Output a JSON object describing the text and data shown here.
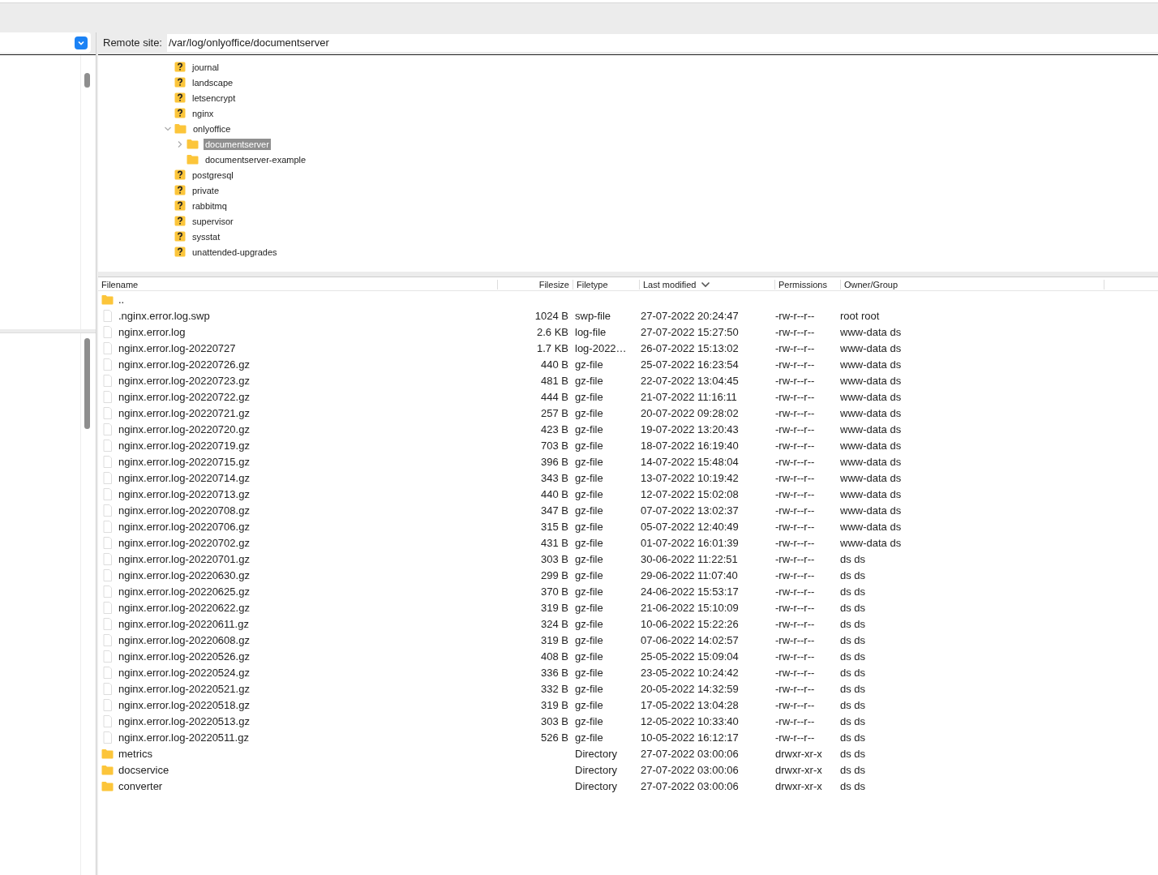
{
  "remote_site": {
    "label": "Remote site:",
    "path": "/var/log/onlyoffice/documentserver"
  },
  "tree": [
    {
      "name": "journal",
      "kind": "unknown",
      "selected": false
    },
    {
      "name": "landscape",
      "kind": "unknown",
      "selected": false
    },
    {
      "name": "letsencrypt",
      "kind": "unknown",
      "selected": false
    },
    {
      "name": "nginx",
      "kind": "unknown",
      "selected": false
    },
    {
      "name": "onlyoffice",
      "kind": "folder",
      "selected": false,
      "expanded": true,
      "children": [
        {
          "name": "documentserver",
          "kind": "folder",
          "selected": true,
          "expanded": false
        },
        {
          "name": "documentserver-example",
          "kind": "folder",
          "selected": false
        }
      ]
    },
    {
      "name": "postgresql",
      "kind": "unknown",
      "selected": false
    },
    {
      "name": "private",
      "kind": "unknown",
      "selected": false
    },
    {
      "name": "rabbitmq",
      "kind": "unknown",
      "selected": false
    },
    {
      "name": "supervisor",
      "kind": "unknown",
      "selected": false
    },
    {
      "name": "sysstat",
      "kind": "unknown",
      "selected": false
    },
    {
      "name": "unattended-upgrades",
      "kind": "unknown",
      "selected": false
    }
  ],
  "columns": [
    {
      "label": "Filename",
      "sorted": false
    },
    {
      "label": "Filesize",
      "sorted": false
    },
    {
      "label": "Filetype",
      "sorted": false
    },
    {
      "label": "Last modified",
      "sorted": true
    },
    {
      "label": "Permissions",
      "sorted": false
    },
    {
      "label": "Owner/Group",
      "sorted": false
    }
  ],
  "rows": [
    {
      "kind": "folder",
      "name": ".."
    },
    {
      "kind": "file",
      "name": ".nginx.error.log.swp",
      "size": "1024 B",
      "type": "swp-file",
      "modified": "27-07-2022 20:24:47",
      "perms": "-rw-r--r--",
      "owner": "root root"
    },
    {
      "kind": "file",
      "name": "nginx.error.log",
      "size": "2.6 KB",
      "type": "log-file",
      "modified": "27-07-2022 15:27:50",
      "perms": "-rw-r--r--",
      "owner": "www-data ds"
    },
    {
      "kind": "file",
      "name": "nginx.error.log-20220727",
      "size": "1.7 KB",
      "type": "log-2022…",
      "modified": "26-07-2022 15:13:02",
      "perms": "-rw-r--r--",
      "owner": "www-data ds"
    },
    {
      "kind": "file",
      "name": "nginx.error.log-20220726.gz",
      "size": "440 B",
      "type": "gz-file",
      "modified": "25-07-2022 16:23:54",
      "perms": "-rw-r--r--",
      "owner": "www-data ds"
    },
    {
      "kind": "file",
      "name": "nginx.error.log-20220723.gz",
      "size": "481 B",
      "type": "gz-file",
      "modified": "22-07-2022 13:04:45",
      "perms": "-rw-r--r--",
      "owner": "www-data ds"
    },
    {
      "kind": "file",
      "name": "nginx.error.log-20220722.gz",
      "size": "444 B",
      "type": "gz-file",
      "modified": "21-07-2022 11:16:11",
      "perms": "-rw-r--r--",
      "owner": "www-data ds"
    },
    {
      "kind": "file",
      "name": "nginx.error.log-20220721.gz",
      "size": "257 B",
      "type": "gz-file",
      "modified": "20-07-2022 09:28:02",
      "perms": "-rw-r--r--",
      "owner": "www-data ds"
    },
    {
      "kind": "file",
      "name": "nginx.error.log-20220720.gz",
      "size": "423 B",
      "type": "gz-file",
      "modified": "19-07-2022 13:20:43",
      "perms": "-rw-r--r--",
      "owner": "www-data ds"
    },
    {
      "kind": "file",
      "name": "nginx.error.log-20220719.gz",
      "size": "703 B",
      "type": "gz-file",
      "modified": "18-07-2022 16:19:40",
      "perms": "-rw-r--r--",
      "owner": "www-data ds"
    },
    {
      "kind": "file",
      "name": "nginx.error.log-20220715.gz",
      "size": "396 B",
      "type": "gz-file",
      "modified": "14-07-2022 15:48:04",
      "perms": "-rw-r--r--",
      "owner": "www-data ds"
    },
    {
      "kind": "file",
      "name": "nginx.error.log-20220714.gz",
      "size": "343 B",
      "type": "gz-file",
      "modified": "13-07-2022 10:19:42",
      "perms": "-rw-r--r--",
      "owner": "www-data ds"
    },
    {
      "kind": "file",
      "name": "nginx.error.log-20220713.gz",
      "size": "440 B",
      "type": "gz-file",
      "modified": "12-07-2022 15:02:08",
      "perms": "-rw-r--r--",
      "owner": "www-data ds"
    },
    {
      "kind": "file",
      "name": "nginx.error.log-20220708.gz",
      "size": "347 B",
      "type": "gz-file",
      "modified": "07-07-2022 13:02:37",
      "perms": "-rw-r--r--",
      "owner": "www-data ds"
    },
    {
      "kind": "file",
      "name": "nginx.error.log-20220706.gz",
      "size": "315 B",
      "type": "gz-file",
      "modified": "05-07-2022 12:40:49",
      "perms": "-rw-r--r--",
      "owner": "www-data ds"
    },
    {
      "kind": "file",
      "name": "nginx.error.log-20220702.gz",
      "size": "431 B",
      "type": "gz-file",
      "modified": "01-07-2022 16:01:39",
      "perms": "-rw-r--r--",
      "owner": "www-data ds"
    },
    {
      "kind": "file",
      "name": "nginx.error.log-20220701.gz",
      "size": "303 B",
      "type": "gz-file",
      "modified": "30-06-2022 11:22:51",
      "perms": "-rw-r--r--",
      "owner": "ds ds"
    },
    {
      "kind": "file",
      "name": "nginx.error.log-20220630.gz",
      "size": "299 B",
      "type": "gz-file",
      "modified": "29-06-2022 11:07:40",
      "perms": "-rw-r--r--",
      "owner": "ds ds"
    },
    {
      "kind": "file",
      "name": "nginx.error.log-20220625.gz",
      "size": "370 B",
      "type": "gz-file",
      "modified": "24-06-2022 15:53:17",
      "perms": "-rw-r--r--",
      "owner": "ds ds"
    },
    {
      "kind": "file",
      "name": "nginx.error.log-20220622.gz",
      "size": "319 B",
      "type": "gz-file",
      "modified": "21-06-2022 15:10:09",
      "perms": "-rw-r--r--",
      "owner": "ds ds"
    },
    {
      "kind": "file",
      "name": "nginx.error.log-20220611.gz",
      "size": "324 B",
      "type": "gz-file",
      "modified": "10-06-2022 15:22:26",
      "perms": "-rw-r--r--",
      "owner": "ds ds"
    },
    {
      "kind": "file",
      "name": "nginx.error.log-20220608.gz",
      "size": "319 B",
      "type": "gz-file",
      "modified": "07-06-2022 14:02:57",
      "perms": "-rw-r--r--",
      "owner": "ds ds"
    },
    {
      "kind": "file",
      "name": "nginx.error.log-20220526.gz",
      "size": "408 B",
      "type": "gz-file",
      "modified": "25-05-2022 15:09:04",
      "perms": "-rw-r--r--",
      "owner": "ds ds"
    },
    {
      "kind": "file",
      "name": "nginx.error.log-20220524.gz",
      "size": "336 B",
      "type": "gz-file",
      "modified": "23-05-2022 10:24:42",
      "perms": "-rw-r--r--",
      "owner": "ds ds"
    },
    {
      "kind": "file",
      "name": "nginx.error.log-20220521.gz",
      "size": "332 B",
      "type": "gz-file",
      "modified": "20-05-2022 14:32:59",
      "perms": "-rw-r--r--",
      "owner": "ds ds"
    },
    {
      "kind": "file",
      "name": "nginx.error.log-20220518.gz",
      "size": "319 B",
      "type": "gz-file",
      "modified": "17-05-2022 13:04:28",
      "perms": "-rw-r--r--",
      "owner": "ds ds"
    },
    {
      "kind": "file",
      "name": "nginx.error.log-20220513.gz",
      "size": "303 B",
      "type": "gz-file",
      "modified": "12-05-2022 10:33:40",
      "perms": "-rw-r--r--",
      "owner": "ds ds"
    },
    {
      "kind": "file",
      "name": "nginx.error.log-20220511.gz",
      "size": "526 B",
      "type": "gz-file",
      "modified": "10-05-2022 16:12:17",
      "perms": "-rw-r--r--",
      "owner": "ds ds"
    },
    {
      "kind": "folder",
      "name": "metrics",
      "type": "Directory",
      "modified": "27-07-2022 03:00:06",
      "perms": "drwxr-xr-x",
      "owner": "ds ds"
    },
    {
      "kind": "folder",
      "name": "docservice",
      "type": "Directory",
      "modified": "27-07-2022 03:00:06",
      "perms": "drwxr-xr-x",
      "owner": "ds ds"
    },
    {
      "kind": "folder",
      "name": "converter",
      "type": "Directory",
      "modified": "27-07-2022 03:00:06",
      "perms": "drwxr-xr-x",
      "owner": "ds ds"
    }
  ]
}
